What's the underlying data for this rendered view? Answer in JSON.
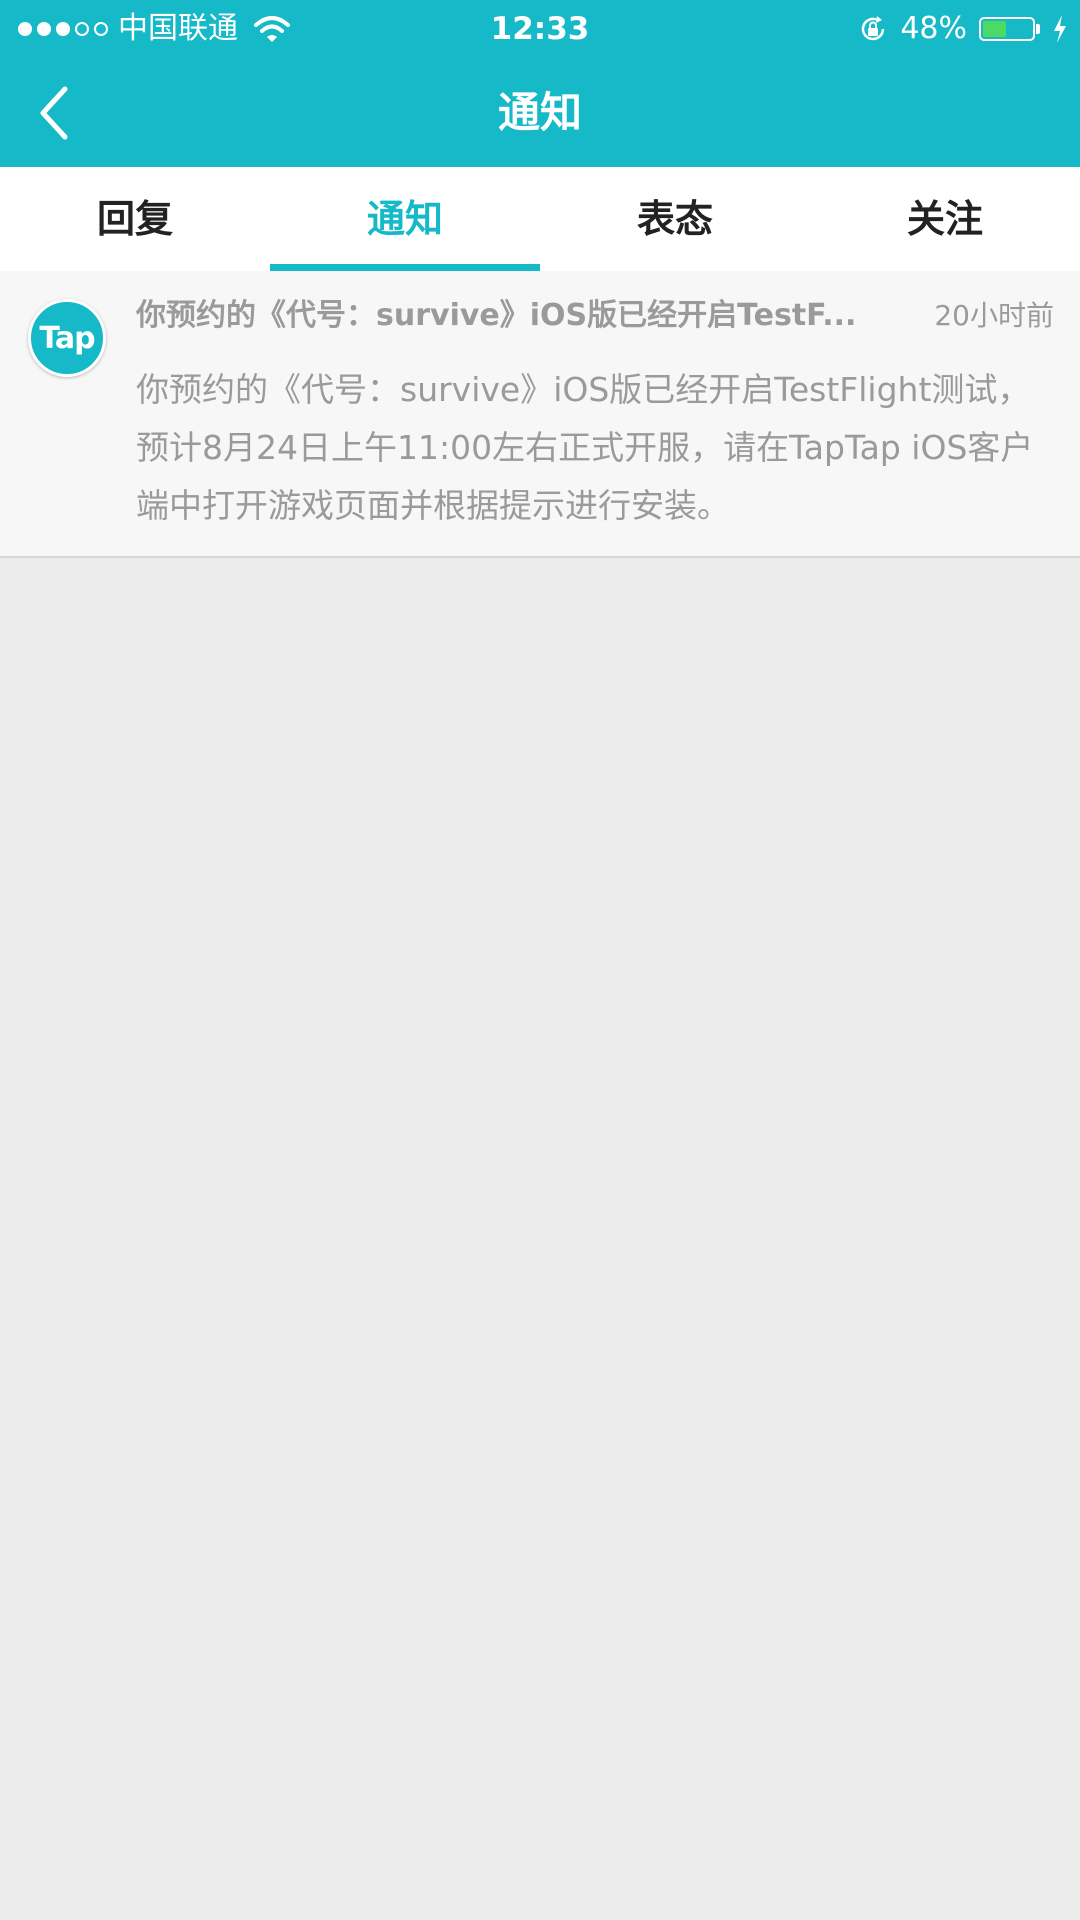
{
  "status_bar": {
    "carrier": "中国联通",
    "time": "12:33",
    "battery_percent": "48%",
    "battery_level": 0.48,
    "icons": [
      "signal-dots-icon",
      "wifi-icon",
      "rotation-lock-icon",
      "battery-icon",
      "charging-bolt-icon"
    ]
  },
  "nav": {
    "title": "通知",
    "back_icon": "chevron-left-icon"
  },
  "tabs": [
    {
      "label": "回复",
      "active": false
    },
    {
      "label": "通知",
      "active": true
    },
    {
      "label": "表态",
      "active": false
    },
    {
      "label": "关注",
      "active": false
    }
  ],
  "notifications": [
    {
      "avatar_text": "Tap",
      "title": "你预约的《代号：survive》iOS版已经开启TestF...",
      "time": "20小时前",
      "body": "你预约的《代号：survive》iOS版已经开启TestFlight测试，预计8月24日上午11:00左右正式开服，请在TapTap iOS客户端中打开游戏页面并根据提示进行安装。"
    }
  ],
  "colors": {
    "accent": "#16b9c7",
    "background": "#ececec",
    "battery_fill": "#4cd964",
    "muted_text": "#9a9a9a"
  }
}
